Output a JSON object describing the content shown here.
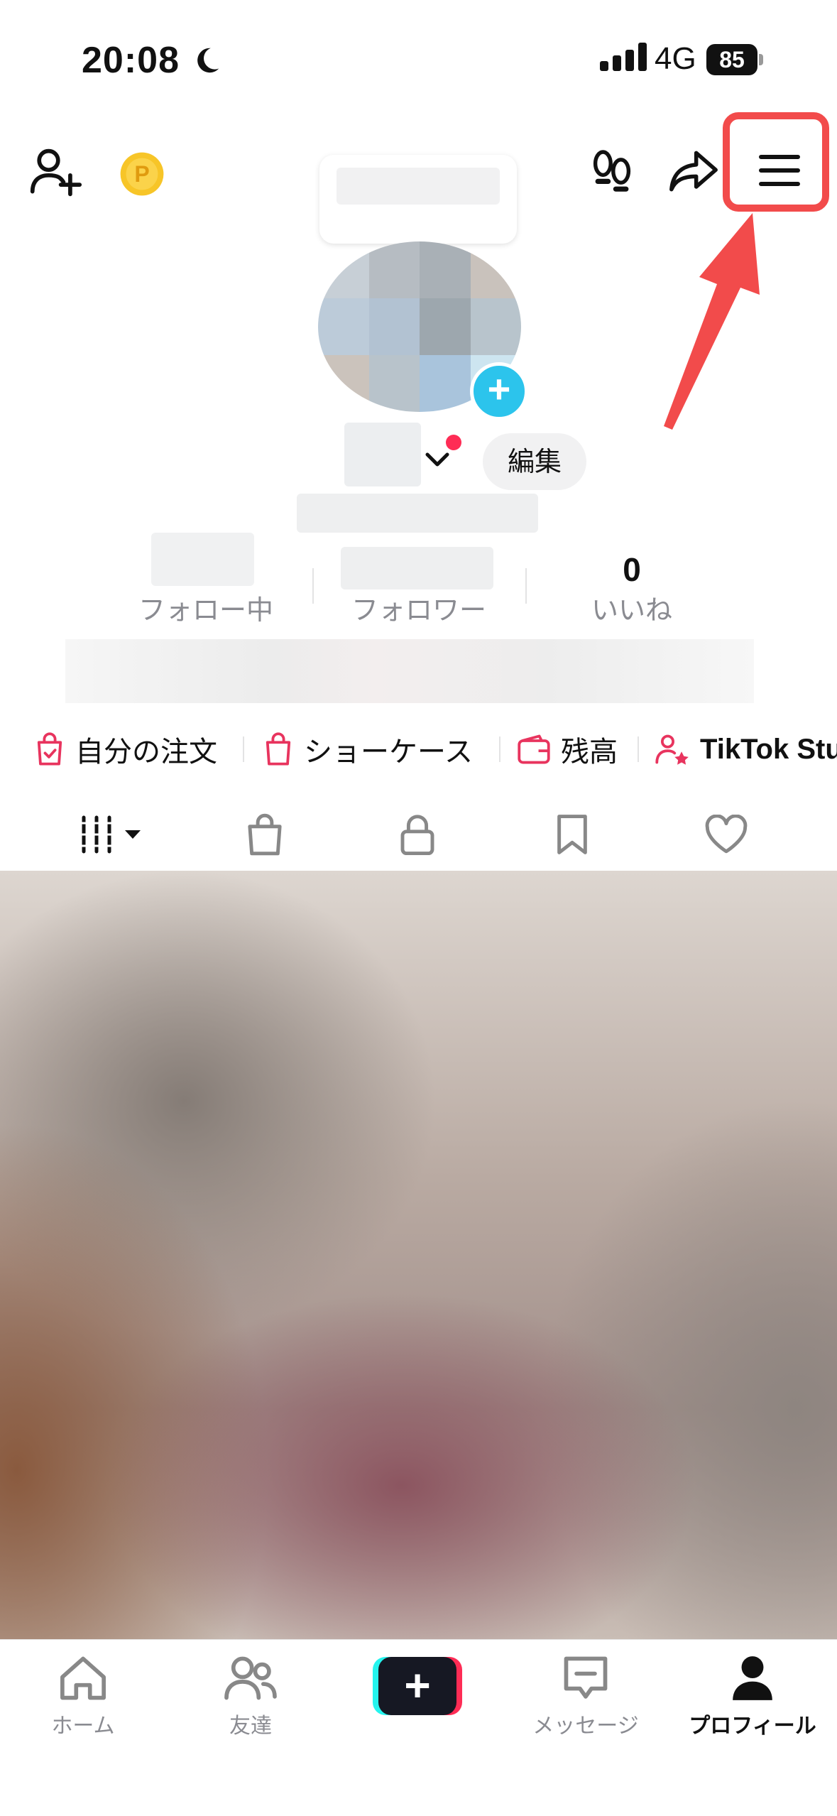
{
  "status_bar": {
    "time": "20:08",
    "network": "4G",
    "battery": "85"
  },
  "profile": {
    "edit_label": "編集",
    "stats": [
      {
        "value": "",
        "label": "フォロー中"
      },
      {
        "value": "",
        "label": "フォロワー"
      },
      {
        "value": "0",
        "label": "いいね"
      }
    ]
  },
  "shortcuts": [
    {
      "label": "自分の注文",
      "icon": "order-bag-icon"
    },
    {
      "label": "ショーケース",
      "icon": "showcase-bag-icon"
    },
    {
      "label": "残高",
      "icon": "wallet-icon"
    },
    {
      "label": "TikTok Stu",
      "icon": "user-star-icon"
    }
  ],
  "content_tabs": [
    "videos-grid-icon",
    "shop-bag-icon",
    "lock-icon",
    "bookmark-icon",
    "heart-icon"
  ],
  "bottom_nav": [
    {
      "label": "ホーム",
      "icon": "home-icon"
    },
    {
      "label": "友達",
      "icon": "friends-icon"
    },
    {
      "label": "",
      "icon": "create-plus-icon"
    },
    {
      "label": "メッセージ",
      "icon": "message-icon"
    },
    {
      "label": "プロフィール",
      "icon": "profile-icon"
    }
  ],
  "colors": {
    "highlight": "#f24b4b",
    "accent_blue": "#2cc4ec",
    "accent_red": "#fe2c55",
    "shop_pink": "#e8345e"
  }
}
